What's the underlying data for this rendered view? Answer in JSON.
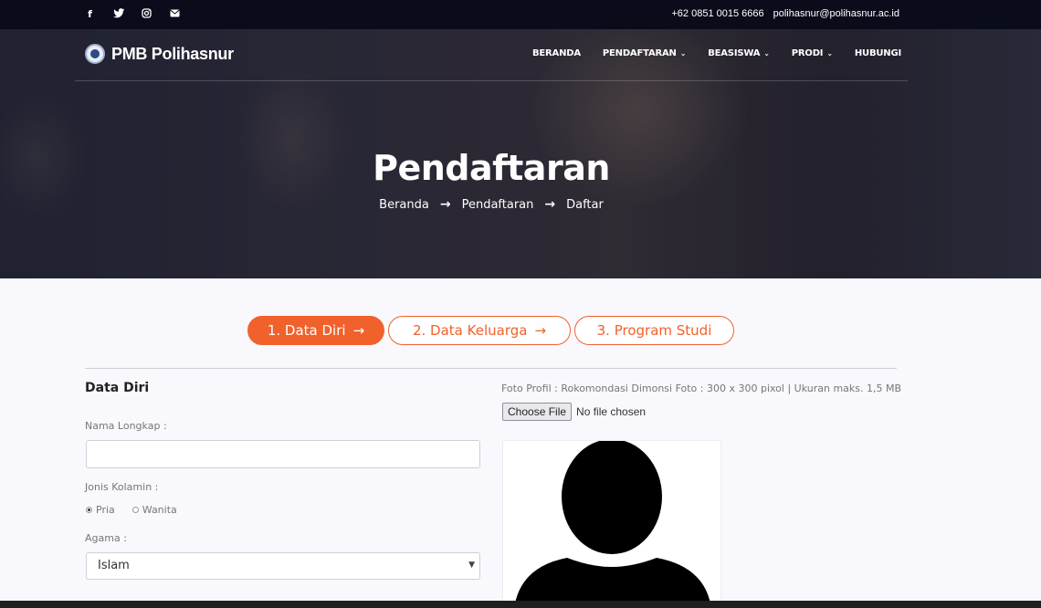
{
  "topbar": {
    "social_icons": [
      "facebook-icon",
      "twitter-icon",
      "instagram-icon",
      "envelope-icon"
    ],
    "phone": "+62 0851 0015 6666",
    "email": "polihasnur@polihasnur.ac.id"
  },
  "navbar": {
    "brand": "PMB Polihasnur",
    "menu": [
      {
        "label": "BERANDA",
        "dropdown": false
      },
      {
        "label": "PENDAFTARAN",
        "dropdown": true
      },
      {
        "label": "BEASISWA",
        "dropdown": true
      },
      {
        "label": "PRODI",
        "dropdown": true
      },
      {
        "label": "HUBUNGI",
        "dropdown": false
      }
    ]
  },
  "hero": {
    "title": "Pendaftaran",
    "breadcrumb": [
      "Beranda",
      "Pendaftaran",
      "Daftar"
    ]
  },
  "steps": [
    {
      "label": "1. Data Diri",
      "active": true
    },
    {
      "label": "2. Data Keluarga",
      "active": false
    },
    {
      "label": "3. Program Studi",
      "active": false
    }
  ],
  "form": {
    "section_title": "Data Diri",
    "nama_label": "Nama Longkap :",
    "nama_value": "",
    "jk_label": "Jonis Kolamin :",
    "jk_options": [
      "Pria",
      "Wanita"
    ],
    "jk_selected": "Pria",
    "agama_label": "Agama :",
    "agama_value": "Islam"
  },
  "photo": {
    "label": "Foto Profil : Rokomondasi Dimonsi Foto : 300 x 300 pixol | Ukuran maks. 1,5 MB",
    "button": "Choose File",
    "status": "No file chosen"
  },
  "colors": {
    "accent": "#f1612b",
    "topbar": "#0a0c1c"
  }
}
